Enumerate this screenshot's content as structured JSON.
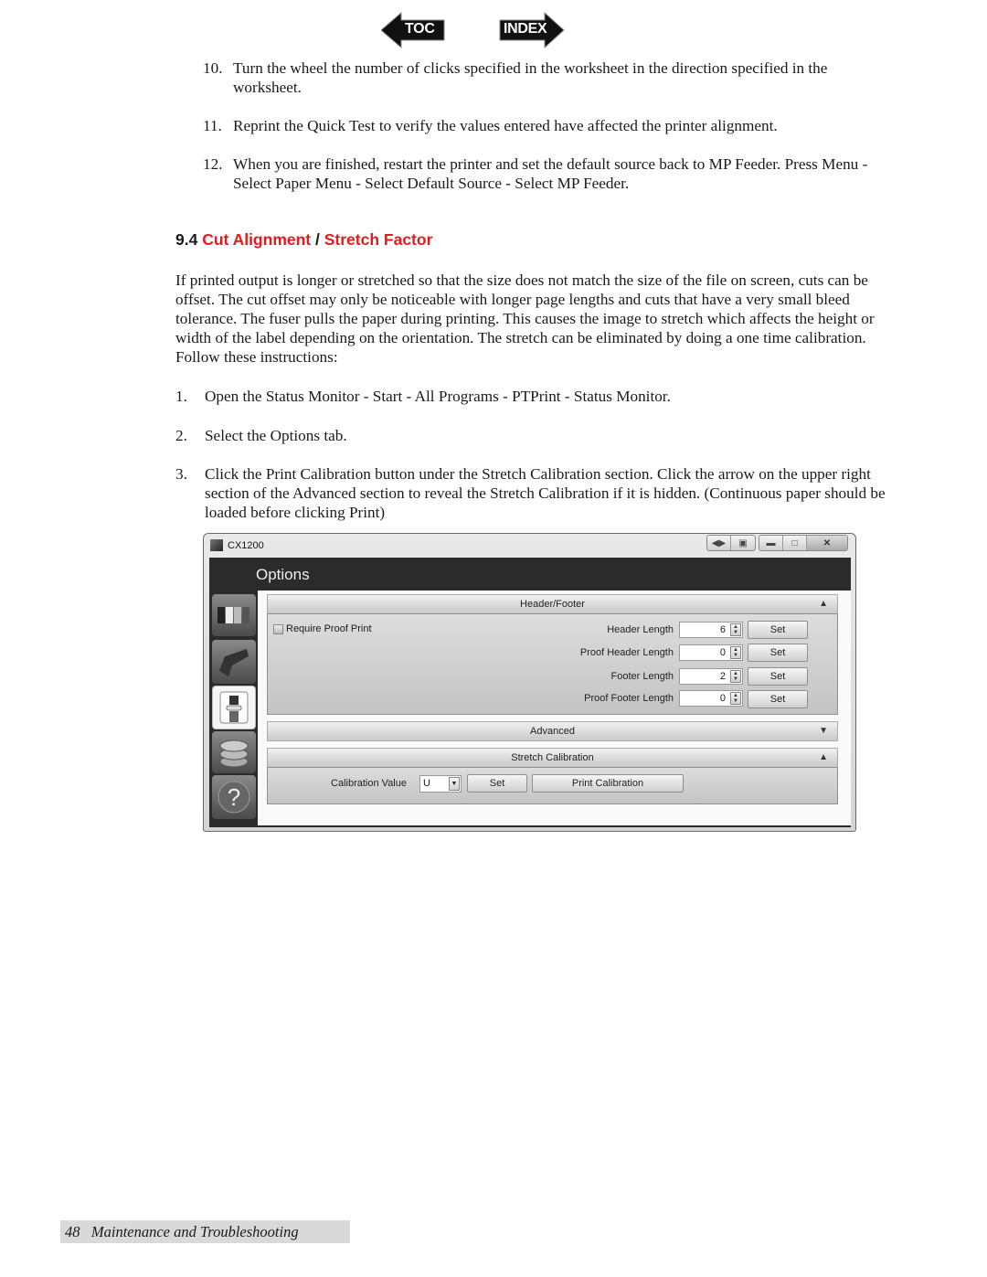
{
  "nav": {
    "toc_label": "TOC",
    "index_label": "INDEX"
  },
  "steps_top": [
    {
      "num": "10.",
      "text": "Turn the wheel the number of clicks specified in the worksheet in the direction specified in the worksheet."
    },
    {
      "num": "11.",
      "text": "Reprint the Quick Test to verify the values entered have affected the printer alignment."
    },
    {
      "num": "12.",
      "text": "When you are finished, restart the printer and set the default source back to MP Feeder. Press Menu - Select Paper Menu - Select Default Source - Select MP Feeder."
    }
  ],
  "section": {
    "number": "9.4",
    "title_part1": "Cut Alignment",
    "separator": "/",
    "title_part2": "Stretch Factor",
    "accent_color": "#e31b1b"
  },
  "intro_paragraph": "If printed output is longer or stretched so that the size does not match the size of the file on screen, cuts can be offset. The cut offset may only be noticeable with longer page lengths and cuts that have a very small bleed tolerance.  The fuser pulls the paper during printing. This causes the image to stretch which affects the height or width of the label depending on the orientation. The stretch can be eliminated by doing a one time calibration.  Follow these instructions:",
  "steps_bottom": [
    {
      "num": "1.",
      "text": "Open the Status Monitor - Start - All Programs - PTPrint - Status Monitor."
    },
    {
      "num": "2.",
      "text": "Select the Options tab."
    },
    {
      "num": "3.",
      "text": "Click the Print Calibration button under the Stretch Calibration section.  Click the arrow on the upper right section of the Advanced section to reveal the Stretch Calibration if it is hidden. (Continuous paper should be loaded before clicking Print)"
    }
  ],
  "window": {
    "title": "CX1200",
    "page_title": "Options",
    "controls": [
      "help-icon",
      "settings-icon",
      "minimize-icon",
      "maximize-icon",
      "close-icon"
    ],
    "sidebar_tabs": [
      "ink-cartridges-icon",
      "printer-icon",
      "options-icon",
      "media-rolls-icon",
      "help-question-icon"
    ],
    "active_tab": "options-icon",
    "header_footer": {
      "title": "Header/Footer",
      "expanded": true,
      "require_proof_print_label": "Require Proof Print",
      "require_proof_print_checked": false,
      "rows": [
        {
          "label": "Header Length",
          "value": "6",
          "button": "Set"
        },
        {
          "label": "Proof Header Length",
          "value": "0",
          "button": "Set"
        },
        {
          "label": "Footer Length",
          "value": "2",
          "button": "Set"
        },
        {
          "label": "Proof Footer Length",
          "value": "0",
          "button": "Set"
        }
      ]
    },
    "advanced": {
      "title": "Advanced",
      "expanded": false
    },
    "stretch_calibration": {
      "title": "Stretch Calibration",
      "expanded": true,
      "calibration_label": "Calibration Value",
      "calibration_value": "U",
      "set_button": "Set",
      "print_button": "Print Calibration"
    }
  },
  "footer": {
    "page_number": "48",
    "chapter": "Maintenance and Troubleshooting"
  }
}
